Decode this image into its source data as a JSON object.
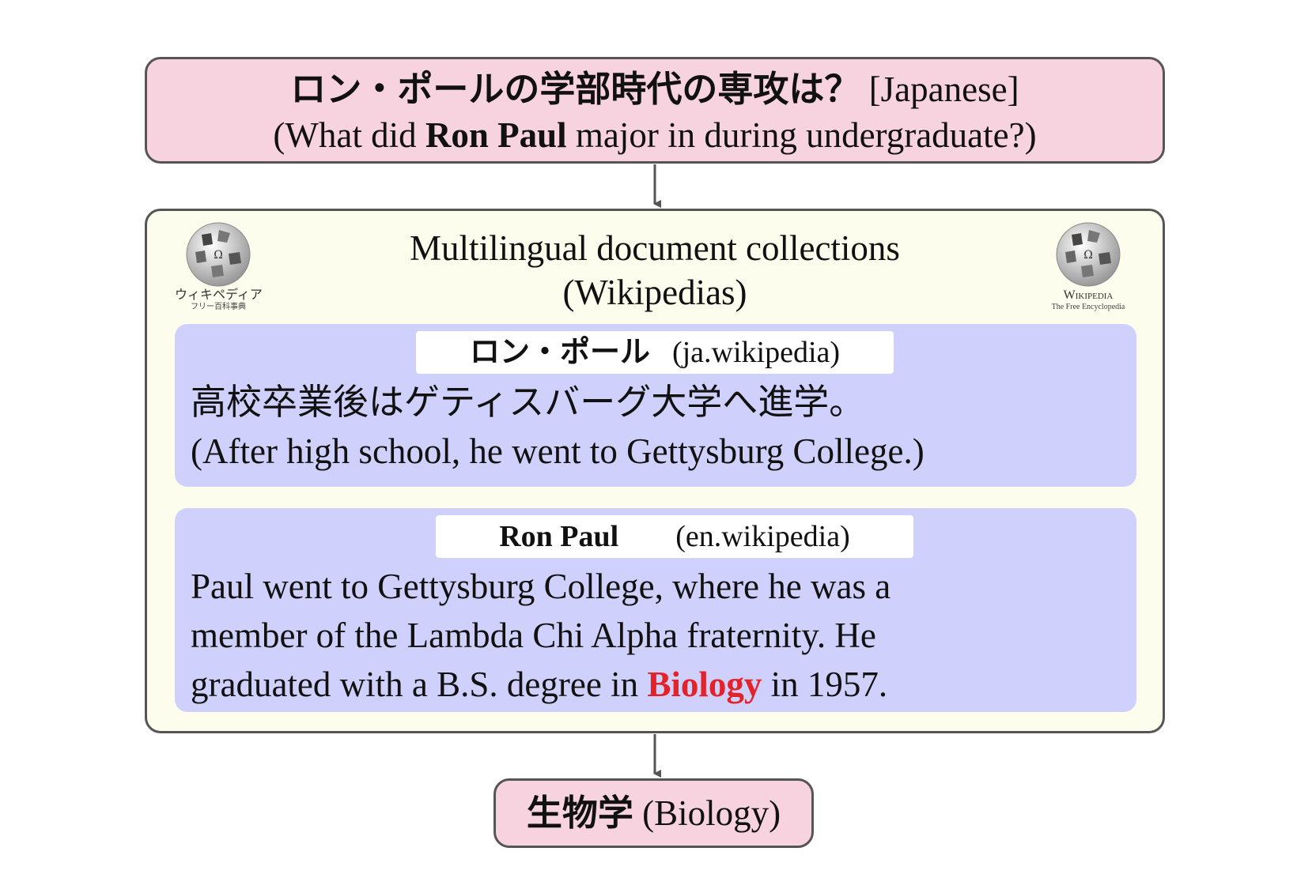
{
  "question": {
    "japanese": "ロン・ポールの学部時代の専攻は？",
    "language_tag": "[Japanese]",
    "translation_prefix": "(What did ",
    "translation_name": "Ron Paul",
    "translation_suffix": " major in during undergraduate?)"
  },
  "collection": {
    "title_line1": "Multilingual document collections",
    "title_line2": "(Wikipedias)",
    "logo_left": {
      "icon": "wikipedia-globe-icon",
      "caption": "ウィキペディア",
      "subcaption": "フリー百科事典"
    },
    "logo_right": {
      "icon": "wikipedia-globe-icon",
      "caption": "Wikipedia",
      "subcaption": "The Free Encyclopedia"
    }
  },
  "doc_ja": {
    "title": "ロン・ポール",
    "source": "(ja.wikipedia)",
    "text_line1": "高校卒業後はゲティスバーグ大学へ進学。",
    "text_line2": "(After high school, he went to Gettysburg College.)"
  },
  "doc_en": {
    "title": "Ron Paul",
    "source": "(en.wikipedia)",
    "text_line1": "Paul went to Gettysburg College, where he was a",
    "text_line2": "member of the Lambda Chi Alpha fraternity. He",
    "text_line3_prefix": "graduated with a B.S. degree in ",
    "text_line3_highlight": "Biology",
    "text_line3_suffix": " in 1957."
  },
  "answer": {
    "japanese": "生物学",
    "translation": "(Biology)"
  },
  "colors": {
    "pink_box": "#f7d3df",
    "collection_bg": "#fdfdee",
    "doc_bg": "#cfd0fb",
    "highlight": "#e3232a",
    "border": "#555555"
  }
}
